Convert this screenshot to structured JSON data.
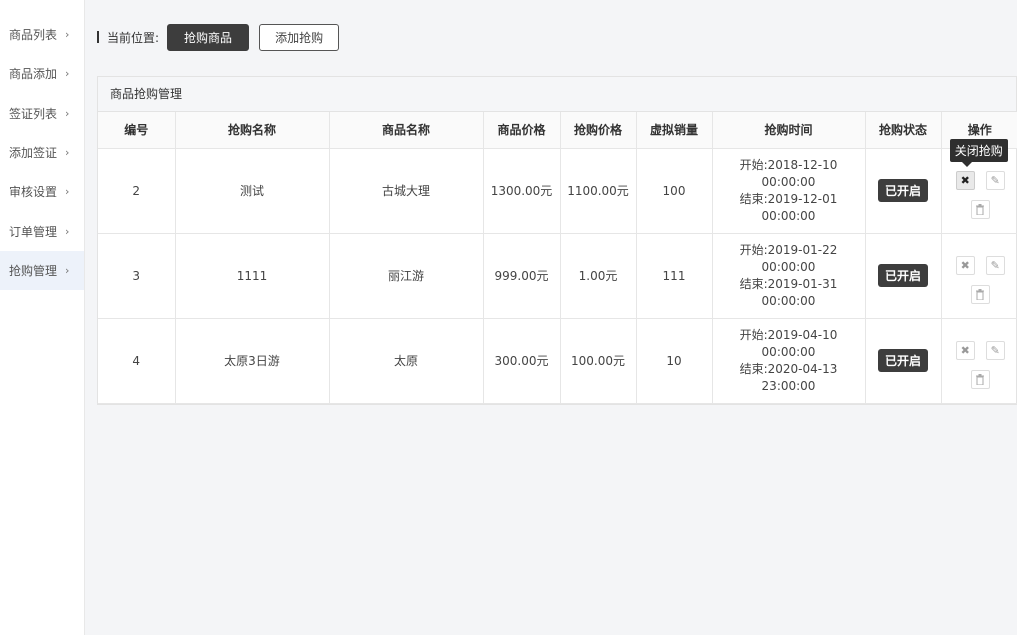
{
  "sidebar": {
    "items": [
      {
        "label": "商品列表",
        "icon": "chevron-right-icon"
      },
      {
        "label": "商品添加",
        "icon": "chevron-right-icon"
      },
      {
        "label": "签证列表",
        "icon": "chevron-right-icon"
      },
      {
        "label": "添加签证",
        "icon": "chevron-right-icon"
      },
      {
        "label": "审核设置",
        "icon": "chevron-right-icon"
      },
      {
        "label": "订单管理",
        "icon": "chevron-right-icon"
      },
      {
        "label": "抢购管理",
        "icon": "chevron-right-icon",
        "active": true
      }
    ]
  },
  "breadcrumb": {
    "label": "当前位置:",
    "current_button": "抢购商品",
    "add_button": "添加抢购"
  },
  "panel": {
    "title": "商品抢购管理",
    "columns": [
      "编号",
      "抢购名称",
      "商品名称",
      "商品价格",
      "抢购价格",
      "虚拟销量",
      "抢购时间",
      "抢购状态",
      "操作"
    ],
    "rows": [
      {
        "id": "2",
        "flash_name": "测试",
        "product_name": "古城大理",
        "price": "1300.00元",
        "flash_price": "1100.00元",
        "virtual_sales": "100",
        "start_label": "开始:",
        "start_date": "2018-12-10",
        "start_time": "00:00:00",
        "end_label": "结束:",
        "end_date": "2019-12-01",
        "end_time": "00:00:00",
        "status": "已开启"
      },
      {
        "id": "3",
        "flash_name": "1111",
        "product_name": "丽江游",
        "price": "999.00元",
        "flash_price": "1.00元",
        "virtual_sales": "111",
        "start_label": "开始:",
        "start_date": "2019-01-22",
        "start_time": "00:00:00",
        "end_label": "结束:",
        "end_date": "2019-01-31",
        "end_time": "00:00:00",
        "status": "已开启"
      },
      {
        "id": "4",
        "flash_name": "太原3日游",
        "product_name": "太原",
        "price": "300.00元",
        "flash_price": "100.00元",
        "virtual_sales": "10",
        "start_label": "开始:",
        "start_date": "2019-04-10",
        "start_time": "00:00:00",
        "end_label": "结束:",
        "end_date": "2020-04-13",
        "end_time": "23:00:00",
        "status": "已开启"
      }
    ],
    "tooltip": "关闭抢购",
    "op_icons": [
      "close-icon",
      "edit-icon",
      "trash-icon"
    ]
  },
  "colors": {
    "dark_button": "#3d3d3d",
    "badge": "#3d3d3d",
    "sidebar_active": "#edf2fa",
    "page_bg": "#f4f5f7"
  }
}
